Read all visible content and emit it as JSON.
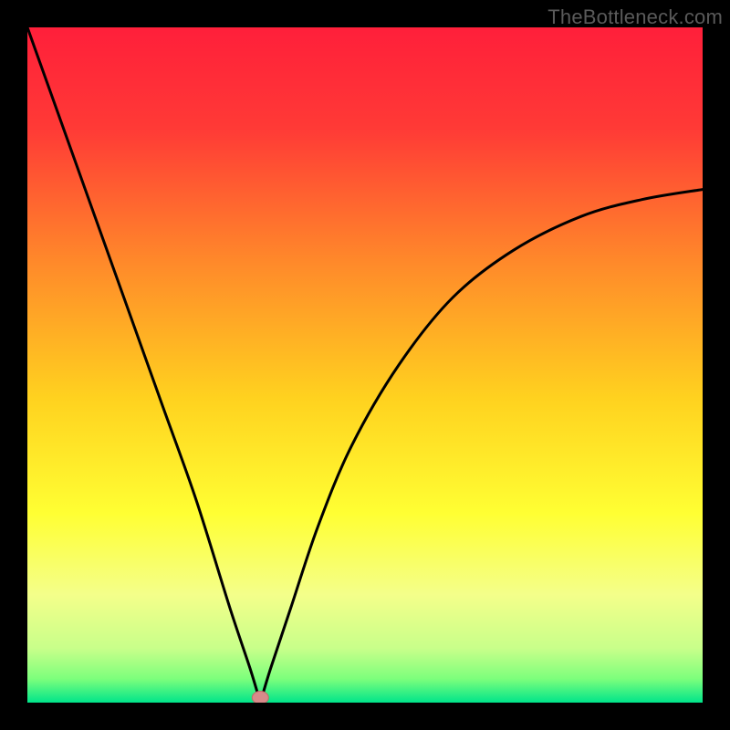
{
  "watermark": "TheBottleneck.com",
  "colors": {
    "background_black": "#000000",
    "curve_stroke": "#000000",
    "marker_fill": "#d88a8a",
    "marker_stroke": "#c06a6a"
  },
  "chart_data": {
    "type": "line",
    "title": "",
    "xlabel": "",
    "ylabel": "",
    "xlim": [
      0,
      1
    ],
    "ylim": [
      0,
      1
    ],
    "gradient_stops": [
      {
        "offset": 0.0,
        "color": "#ff1f3a"
      },
      {
        "offset": 0.15,
        "color": "#ff3a36"
      },
      {
        "offset": 0.35,
        "color": "#ff8a2a"
      },
      {
        "offset": 0.55,
        "color": "#ffd21f"
      },
      {
        "offset": 0.72,
        "color": "#ffff33"
      },
      {
        "offset": 0.84,
        "color": "#f4ff8a"
      },
      {
        "offset": 0.92,
        "color": "#c8ff8a"
      },
      {
        "offset": 0.965,
        "color": "#7cff7c"
      },
      {
        "offset": 1.0,
        "color": "#00e58a"
      }
    ],
    "curve": {
      "vertex_x": 0.345,
      "x": [
        0.0,
        0.05,
        0.1,
        0.15,
        0.2,
        0.25,
        0.3,
        0.33,
        0.345,
        0.36,
        0.39,
        0.43,
        0.48,
        0.55,
        0.63,
        0.72,
        0.82,
        0.91,
        1.0
      ],
      "y": [
        1.0,
        0.86,
        0.72,
        0.58,
        0.44,
        0.3,
        0.14,
        0.05,
        0.0,
        0.05,
        0.14,
        0.26,
        0.38,
        0.5,
        0.6,
        0.67,
        0.72,
        0.745,
        0.76
      ]
    },
    "marker": {
      "x": 0.345,
      "y": 0.002
    }
  }
}
